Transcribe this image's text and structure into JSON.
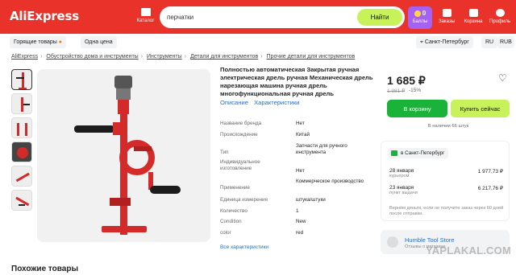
{
  "header": {
    "logo": "AliExpress",
    "catalog_label": "Каталог",
    "search_value": "перчатки",
    "search_button": "Найти",
    "icons": [
      {
        "name": "balls",
        "label": "Баллы",
        "count": "0",
        "icon": "coin-icon"
      },
      {
        "name": "orders",
        "label": "Заказы",
        "icon": "box-icon"
      },
      {
        "name": "cart",
        "label": "Корзина",
        "icon": "cart-icon"
      },
      {
        "name": "profile",
        "label": "Профиль",
        "icon": "user-icon"
      }
    ]
  },
  "subbar": {
    "hot_deals": "Горящие товары",
    "one_price": "Одна цена",
    "city": "Санкт-Петербург",
    "lang": "RU",
    "currency": "RUB"
  },
  "breadcrumbs": [
    "AliExpress",
    "Обустройство дома и инструменты",
    "Инструменты",
    "Детали для инструментов",
    "Прочие детали для инструментов"
  ],
  "product": {
    "title": "Полностью автоматическая Закрытая ручная электрическая дрель ручная Механическая дрель нарезающая машина ручная дрель многофункциональная ручная дрель",
    "tab_description": "Описание",
    "tab_specs": "Характеристики",
    "specs": [
      {
        "k": "Название бренда",
        "v": "Нет"
      },
      {
        "k": "Происхождение",
        "v": "Китай"
      },
      {
        "k": "Тип",
        "v": "Запчасти для ручного инструмента"
      },
      {
        "k": "Индивидуальное изготовление",
        "v": "Нет"
      },
      {
        "k": "Применение",
        "v": "Коммерческое производство"
      },
      {
        "k": "Единица измерения",
        "v": "штука/штуки"
      },
      {
        "k": "Количество",
        "v": "1"
      },
      {
        "k": "Condition",
        "v": "New"
      },
      {
        "k": "color",
        "v": "red"
      }
    ],
    "all_specs_link": "Все характеристики"
  },
  "buy": {
    "price": "1 685 ₽",
    "old_price": "1 981 ₽",
    "discount": "-15%",
    "add_to_cart": "В корзину",
    "buy_now": "Купить сейчас",
    "stock": "В наличии 66 штук"
  },
  "delivery": {
    "city": "в Санкт-Петербург",
    "options": [
      {
        "date": "28 января",
        "sub": "курьером",
        "price": "1 977,73 ₽"
      },
      {
        "date": "23 января",
        "sub": "пункт выдачи",
        "price": "6 217,76 ₽"
      }
    ],
    "refund_note": "Вернём деньги, если не получите заказ через 60 дней после отправки."
  },
  "store": {
    "name": "Humble Tool Store",
    "sub": "Отзывы о магазине"
  },
  "similar_title": "Похожие товары",
  "watermark": "YAPLAKAL.COM",
  "colors": {
    "brand_red": "#e8322a",
    "accent_lime": "#c8f25a",
    "buy_green": "#19b339",
    "link_blue": "#1f6fd1"
  }
}
